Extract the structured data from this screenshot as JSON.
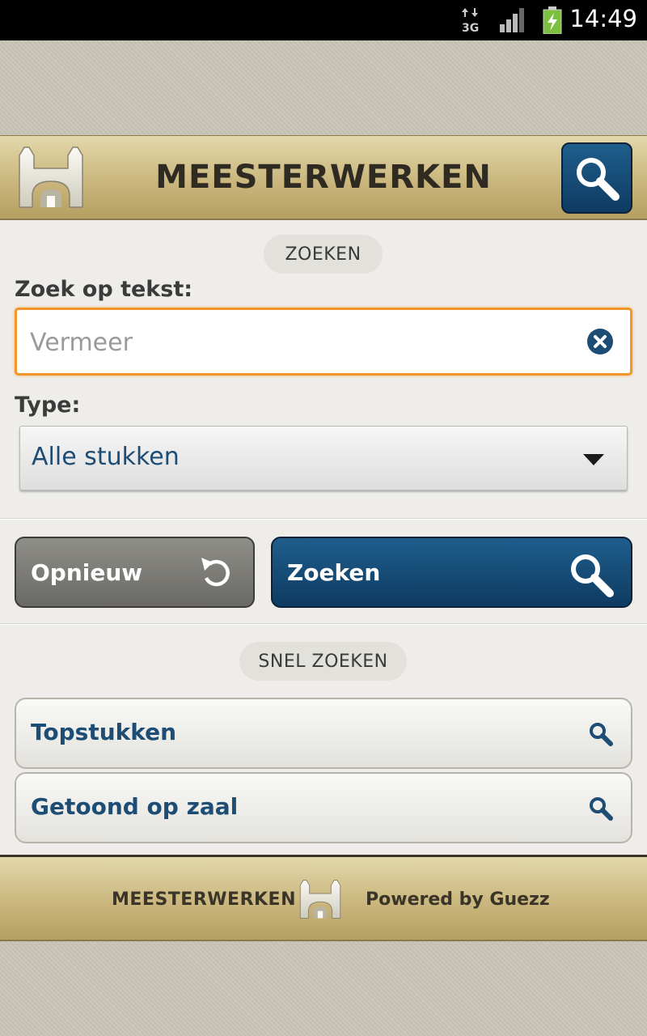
{
  "status_bar": {
    "time": "14:49",
    "network": "3G",
    "icons": [
      "network-3g-icon",
      "signal-icon",
      "battery-charging-icon"
    ]
  },
  "header": {
    "title": "MEESTERWERKEN",
    "logo_icon": "castle-gate-logo-icon",
    "search_icon": "search-icon",
    "accent_color": "#0d3b62"
  },
  "search_section": {
    "heading": "ZOEKEN",
    "text_label": "Zoek op tekst:",
    "text_placeholder": "Vermeer",
    "text_value": "",
    "clear_icon": "clear-x-icon",
    "type_label": "Type:",
    "type_selected": "Alle stukken"
  },
  "actions": {
    "reset_label": "Opnieuw",
    "reset_icon": "refresh-icon",
    "search_label": "Zoeken",
    "search_icon": "search-icon"
  },
  "quick_search": {
    "heading": "SNEL ZOEKEN",
    "items": [
      {
        "label": "Topstukken",
        "icon": "search-icon"
      },
      {
        "label": "Getoond op zaal",
        "icon": "search-icon"
      }
    ]
  },
  "footer": {
    "left_text": "MEESTERWERKEN",
    "right_text": "Powered by Guezz",
    "logo_icon": "castle-gate-logo-icon"
  }
}
